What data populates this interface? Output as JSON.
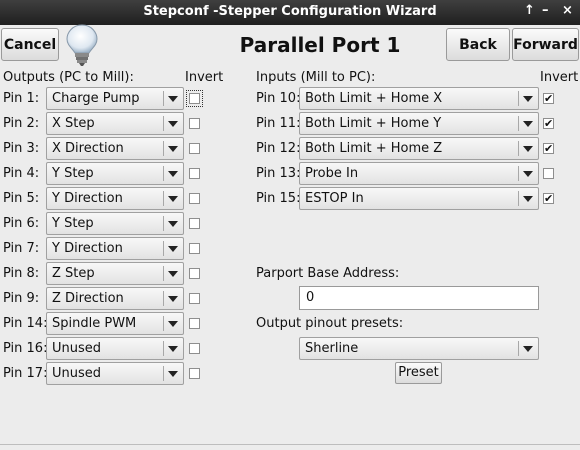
{
  "window": {
    "title": "Stepconf -Stepper Configuration Wizard",
    "controls": [
      "↑",
      "–",
      "×"
    ]
  },
  "toolbar": {
    "cancel_label": "Cancel",
    "back_label": "Back",
    "forward_label": "Forward",
    "page_title": "Parallel Port 1",
    "icon": "lightbulb-icon"
  },
  "outputs": {
    "header": "Outputs (PC to Mill):",
    "invert_header": "Invert",
    "pins": [
      {
        "label": "Pin 1:",
        "value": "Charge Pump",
        "invert": false
      },
      {
        "label": "Pin 2:",
        "value": "X Step",
        "invert": false
      },
      {
        "label": "Pin 3:",
        "value": "X Direction",
        "invert": false
      },
      {
        "label": "Pin 4:",
        "value": "Y Step",
        "invert": false
      },
      {
        "label": "Pin 5:",
        "value": "Y Direction",
        "invert": false
      },
      {
        "label": "Pin 6:",
        "value": "Y Step",
        "invert": false
      },
      {
        "label": "Pin 7:",
        "value": "Y Direction",
        "invert": false
      },
      {
        "label": "Pin 8:",
        "value": "Z Step",
        "invert": false
      },
      {
        "label": "Pin 9:",
        "value": "Z Direction",
        "invert": false
      },
      {
        "label": "Pin 14:",
        "value": "Spindle PWM",
        "invert": false
      },
      {
        "label": "Pin 16:",
        "value": "Unused",
        "invert": false
      },
      {
        "label": "Pin 17:",
        "value": "Unused",
        "invert": false
      }
    ]
  },
  "inputs": {
    "header": "Inputs (Mill to PC):",
    "invert_header": "Invert",
    "pins": [
      {
        "label": "Pin 10:",
        "value": "Both Limit + Home X",
        "invert": true
      },
      {
        "label": "Pin 11:",
        "value": "Both Limit + Home Y",
        "invert": true
      },
      {
        "label": "Pin 12:",
        "value": "Both Limit + Home Z",
        "invert": true
      },
      {
        "label": "Pin 13:",
        "value": "Probe In",
        "invert": false
      },
      {
        "label": "Pin 15:",
        "value": "ESTOP In",
        "invert": true
      }
    ]
  },
  "parport": {
    "base_label": "Parport Base Address:",
    "base_value": "0",
    "presets_label": "Output pinout presets:",
    "preset_value": "Sherline",
    "preset_button": "Preset"
  },
  "colors": {
    "titlebar": "#2a2a2a",
    "window_bg": "#ececec"
  }
}
